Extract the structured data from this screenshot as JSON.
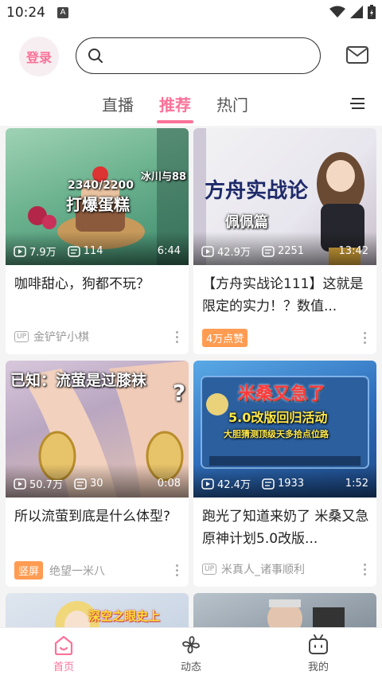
{
  "status": {
    "time": "10:24",
    "keyboard_indicator": "A"
  },
  "header": {
    "login_label": "登录",
    "search_placeholder": ""
  },
  "tabs": [
    {
      "label": "直播",
      "active": false
    },
    {
      "label": "推荐",
      "active": true
    },
    {
      "label": "热门",
      "active": false
    }
  ],
  "cards": [
    {
      "overlay": [
        "2340/2200",
        "打爆蛋糕",
        "冰川与88"
      ],
      "views": "7.9万",
      "danmaku": "114",
      "duration": "6:44",
      "title": "咖啡甜心，狗都不玩？",
      "uploader": "金铲铲小棋",
      "badge": "UP",
      "tag": ""
    },
    {
      "overlay": [
        "方舟实战论",
        "佩佩篇"
      ],
      "views": "42.9万",
      "danmaku": "2251",
      "duration": "13:42",
      "title": "【方舟实战论111】这就是限定的实力！？数值...",
      "uploader": "",
      "badge": "",
      "tag": "4万点赞"
    },
    {
      "overlay": [
        "已知：流萤是过膝袜"
      ],
      "views": "50.7万",
      "danmaku": "30",
      "duration": "0:08",
      "title": "所以流萤到底是什么体型?",
      "uploader": "绝望一米八",
      "badge": "",
      "tag": "竖屏"
    },
    {
      "overlay": [
        "米桑又急了",
        "5.0改版回归活动",
        "大胆猜测顶级天多拾点位路"
      ],
      "views": "42.4万",
      "danmaku": "1933",
      "duration": "1:52",
      "title": "跑光了知道来奶了 米桑又急 原神计划5.0改版...",
      "uploader": "米真人_诸事顺利",
      "badge": "UP",
      "tag": ""
    },
    {
      "overlay": [
        "深空之眼史上"
      ]
    },
    {
      "overlay": []
    }
  ],
  "bottom_nav": [
    {
      "label": "首页",
      "active": true
    },
    {
      "label": "动态",
      "active": false
    },
    {
      "label": "我的",
      "active": false
    }
  ],
  "colors": {
    "accent": "#fb7299",
    "tag_orange": "#ff9c52"
  }
}
